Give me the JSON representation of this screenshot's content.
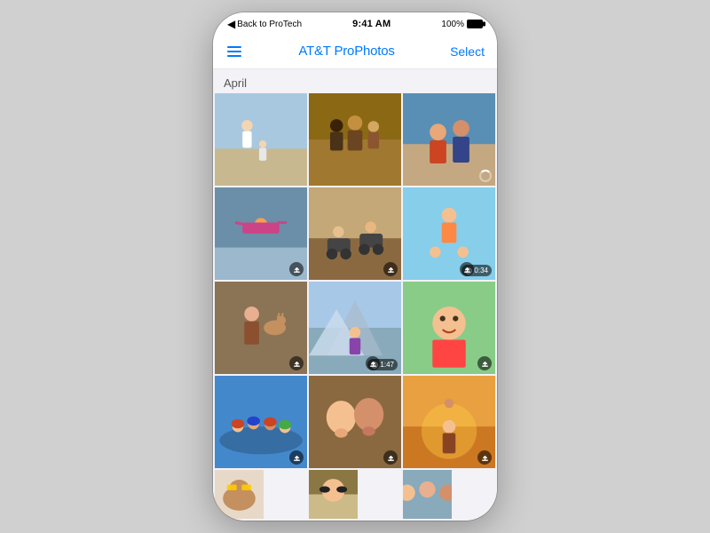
{
  "statusBar": {
    "back_text": "Back to ProTech",
    "time": "9:41 AM",
    "battery": "100%"
  },
  "navBar": {
    "title": "AT&T ProPhotos",
    "select_label": "Select",
    "menu_icon": "hamburger-icon"
  },
  "content": {
    "month_label": "April",
    "photos": [
      {
        "id": 1,
        "row": 1,
        "col": 1,
        "has_upload": false,
        "has_video": false,
        "color_class": "p1"
      },
      {
        "id": 2,
        "row": 1,
        "col": 2,
        "has_upload": false,
        "has_video": false,
        "color_class": "p2"
      },
      {
        "id": 3,
        "row": 1,
        "col": 3,
        "has_upload": false,
        "has_video": false,
        "has_spinner": true,
        "color_class": "p3"
      },
      {
        "id": 4,
        "row": 2,
        "col": 1,
        "has_upload": true,
        "has_video": false,
        "color_class": "p4"
      },
      {
        "id": 5,
        "row": 2,
        "col": 2,
        "has_upload": true,
        "has_video": false,
        "color_class": "p5"
      },
      {
        "id": 6,
        "row": 2,
        "col": 3,
        "has_upload": true,
        "has_video": true,
        "video_duration": "0:34",
        "color_class": "p6"
      },
      {
        "id": 7,
        "row": 3,
        "col": 1,
        "has_upload": true,
        "has_video": false,
        "color_class": "p7"
      },
      {
        "id": 8,
        "row": 3,
        "col": 2,
        "has_upload": true,
        "has_video": true,
        "video_duration": "1:47",
        "color_class": "p8"
      },
      {
        "id": 9,
        "row": 3,
        "col": 3,
        "has_upload": true,
        "has_video": false,
        "color_class": "p9"
      },
      {
        "id": 10,
        "row": 4,
        "col": 1,
        "has_upload": true,
        "has_video": false,
        "color_class": "p10"
      },
      {
        "id": 11,
        "row": 4,
        "col": 2,
        "has_upload": true,
        "has_video": false,
        "color_class": "p11"
      },
      {
        "id": 12,
        "row": 4,
        "col": 3,
        "has_upload": true,
        "has_video": false,
        "color_class": "p12"
      },
      {
        "id": 13,
        "row": 5,
        "col": 1,
        "has_upload": false,
        "has_video": false,
        "color_class": "p13"
      },
      {
        "id": 14,
        "row": 5,
        "col": 2,
        "has_upload": false,
        "has_video": false,
        "color_class": "p14"
      },
      {
        "id": 15,
        "row": 5,
        "col": 3,
        "has_upload": false,
        "has_video": false,
        "color_class": "p15"
      }
    ]
  },
  "colors": {
    "accent": "#007AFF",
    "background": "#f2f2f7",
    "divider": "#e8e8e8"
  }
}
